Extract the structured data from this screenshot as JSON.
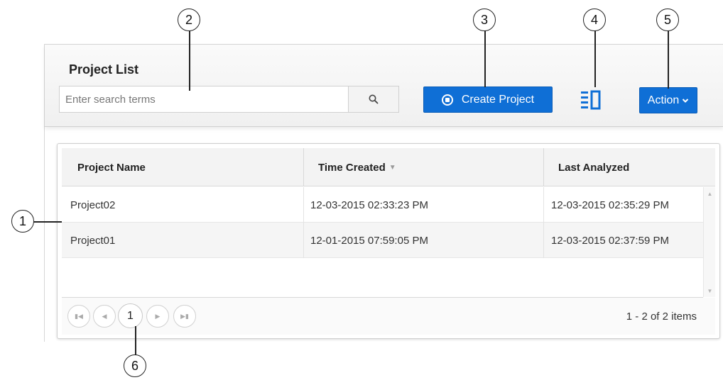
{
  "panel": {
    "title": "Project List",
    "search": {
      "placeholder": "Enter search terms",
      "button_icon": "search-icon"
    },
    "create_button": {
      "label": "Create Project",
      "icon": "project-icon"
    },
    "columns_button": {
      "icon": "column-chooser-icon"
    },
    "action_button": {
      "label": "Action",
      "icon": "chevron-down-icon"
    }
  },
  "grid": {
    "columns": [
      {
        "label": "Project Name"
      },
      {
        "label": "Time Created",
        "sort": "descending"
      },
      {
        "label": "Last Analyzed"
      }
    ],
    "rows": [
      {
        "name": "Project02",
        "created": "12-03-2015 02:33:23 PM",
        "analyzed": "12-03-2015 02:35:29 PM"
      },
      {
        "name": "Project01",
        "created": "12-01-2015 07:59:05 PM",
        "analyzed": "12-03-2015 02:37:59 PM"
      }
    ],
    "pager": {
      "current_page": "1",
      "info": "1 - 2 of 2 items"
    }
  },
  "callouts": [
    "1",
    "2",
    "3",
    "4",
    "5",
    "6"
  ],
  "colors": {
    "primary_button": "#0f6fd6",
    "header_bg": "#f3f3f3"
  }
}
